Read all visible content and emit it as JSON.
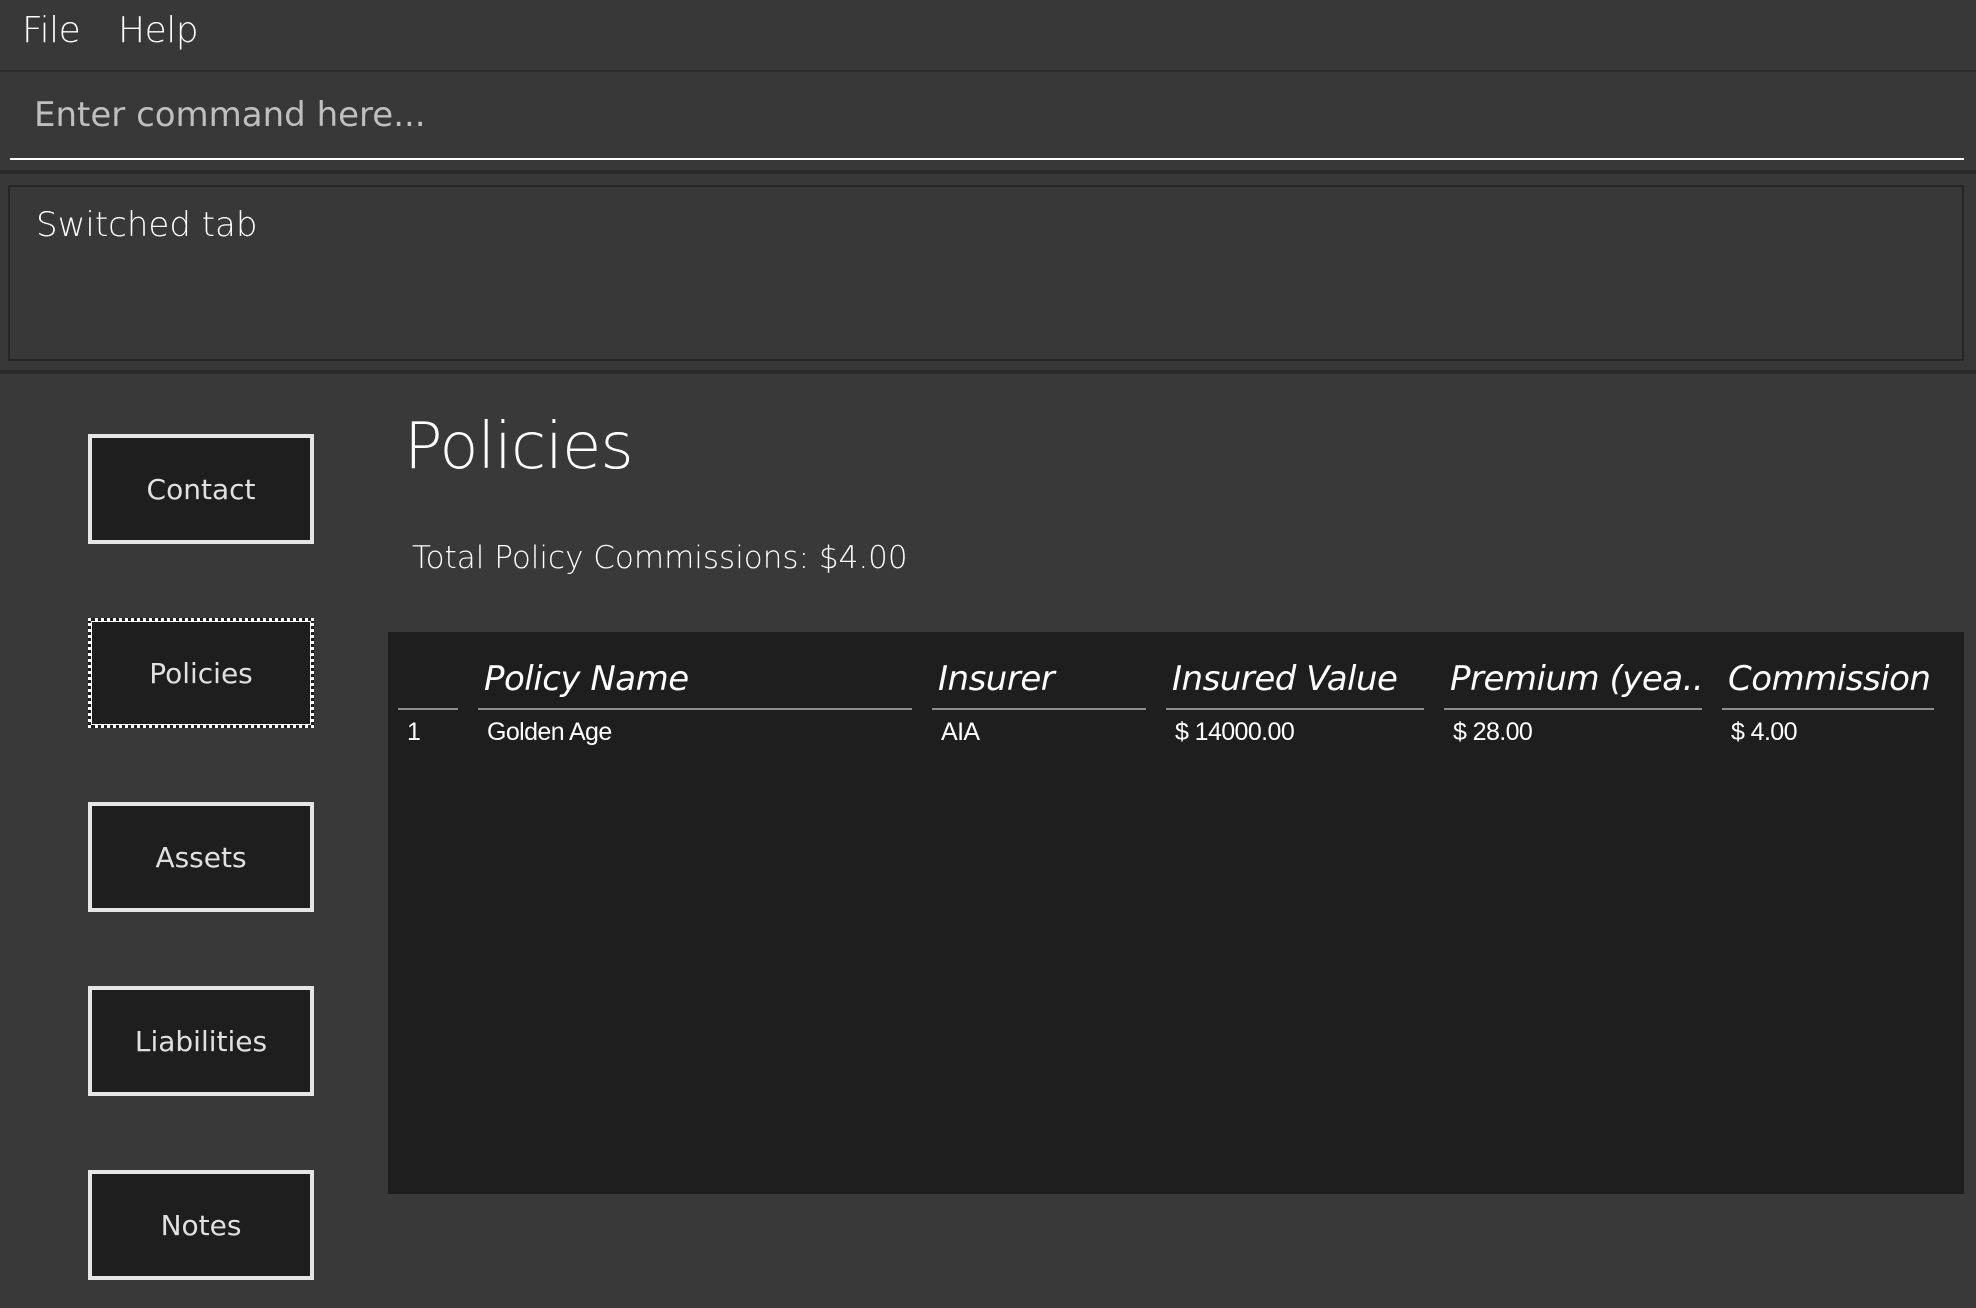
{
  "menu": {
    "items": [
      {
        "label": "File"
      },
      {
        "label": "Help"
      }
    ]
  },
  "command": {
    "placeholder": "Enter command here...",
    "value": ""
  },
  "result": {
    "message": "Switched tab"
  },
  "sidebar": {
    "tabs": [
      {
        "label": "Contact",
        "selected": false
      },
      {
        "label": "Policies",
        "selected": true
      },
      {
        "label": "Assets",
        "selected": false
      },
      {
        "label": "Liabilities",
        "selected": false
      },
      {
        "label": "Notes",
        "selected": false
      }
    ]
  },
  "main": {
    "title": "Policies",
    "summary": "Total Policy Commissions: $4.00",
    "table": {
      "columns": [
        {
          "label": ""
        },
        {
          "label": "Policy Name"
        },
        {
          "label": "Insurer"
        },
        {
          "label": "Insured Value"
        },
        {
          "label": "Premium (yea..."
        },
        {
          "label": "Commission"
        }
      ],
      "rows": [
        {
          "index": "1",
          "policy_name": "Golden Age",
          "insurer": "AIA",
          "insured_value": "$ 14000.00",
          "premium": "$ 28.00",
          "commission": "$ 4.00"
        }
      ]
    }
  },
  "colors": {
    "background": "#393939",
    "panel": "#1e1e1e",
    "text": "#ffffff",
    "button_border": "#e6e6e6"
  }
}
